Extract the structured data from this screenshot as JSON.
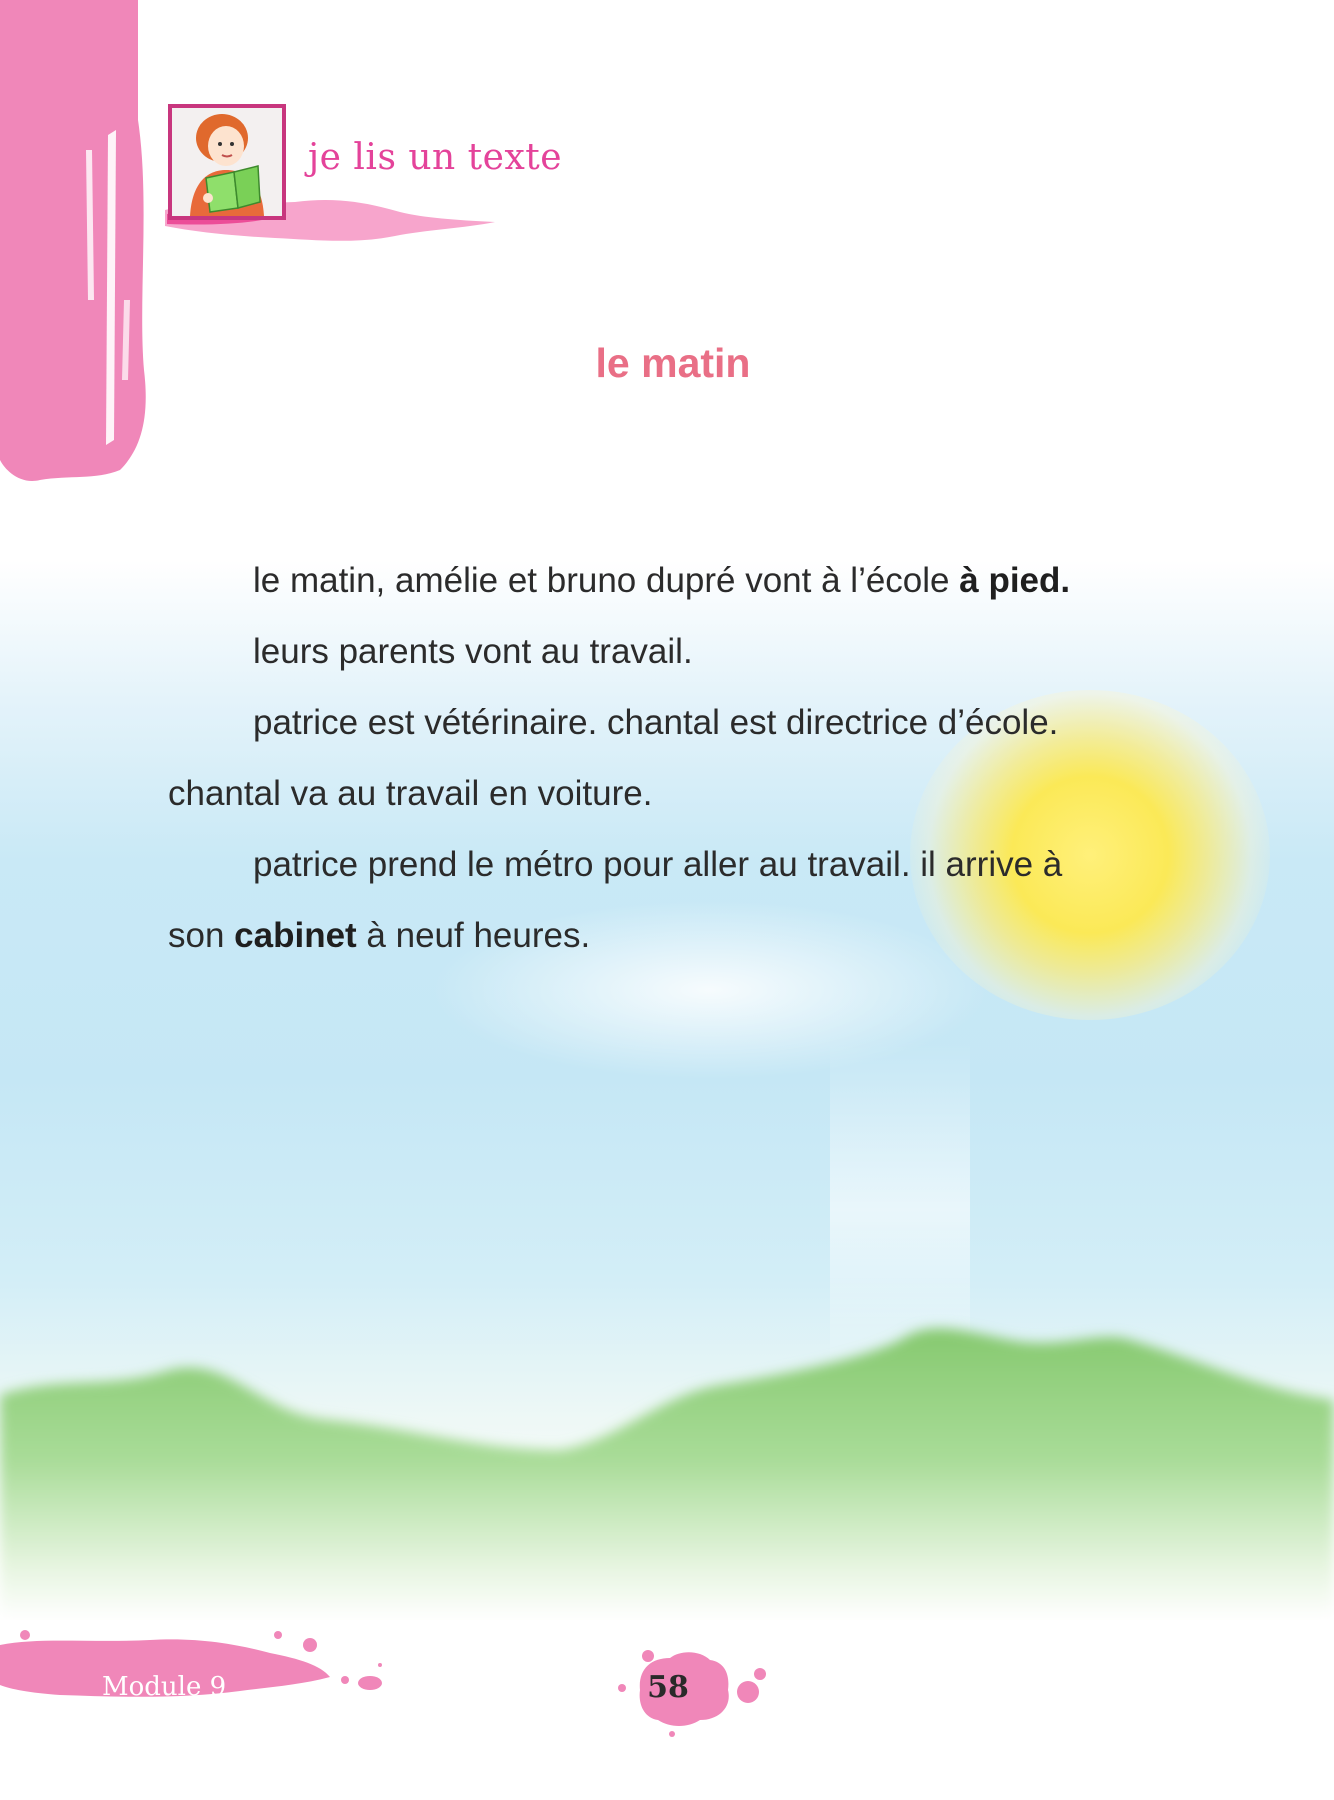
{
  "header": {
    "section_label": "je lis un texte",
    "illustration_icon": "girl-reading-book-icon"
  },
  "title": "le matin",
  "text": {
    "p1": {
      "before": "le matin, amélie et bruno dupré vont à l’école ",
      "bold": "à pied."
    },
    "p2": "leurs parents vont au travail.",
    "p3_indent": "patrice est vétérinaire. chantal est directrice d’école.",
    "p3_cont": "chantal va au travail en voiture.",
    "p4_indent": "patrice prend le métro pour aller au travail. il arrive à",
    "p4_cont": {
      "before": "son ",
      "bold": "cabinet",
      "after": " à neuf heures."
    }
  },
  "footer": {
    "module": "Module 9",
    "page_number": "58"
  },
  "colors": {
    "accent_pink": "#f087b9",
    "title_pink": "#e96f86",
    "label_pink": "#e4439a",
    "sun_yellow": "#fbe957",
    "hill_green": "#8fcf7a",
    "sky_blue": "#c5e7f5"
  }
}
